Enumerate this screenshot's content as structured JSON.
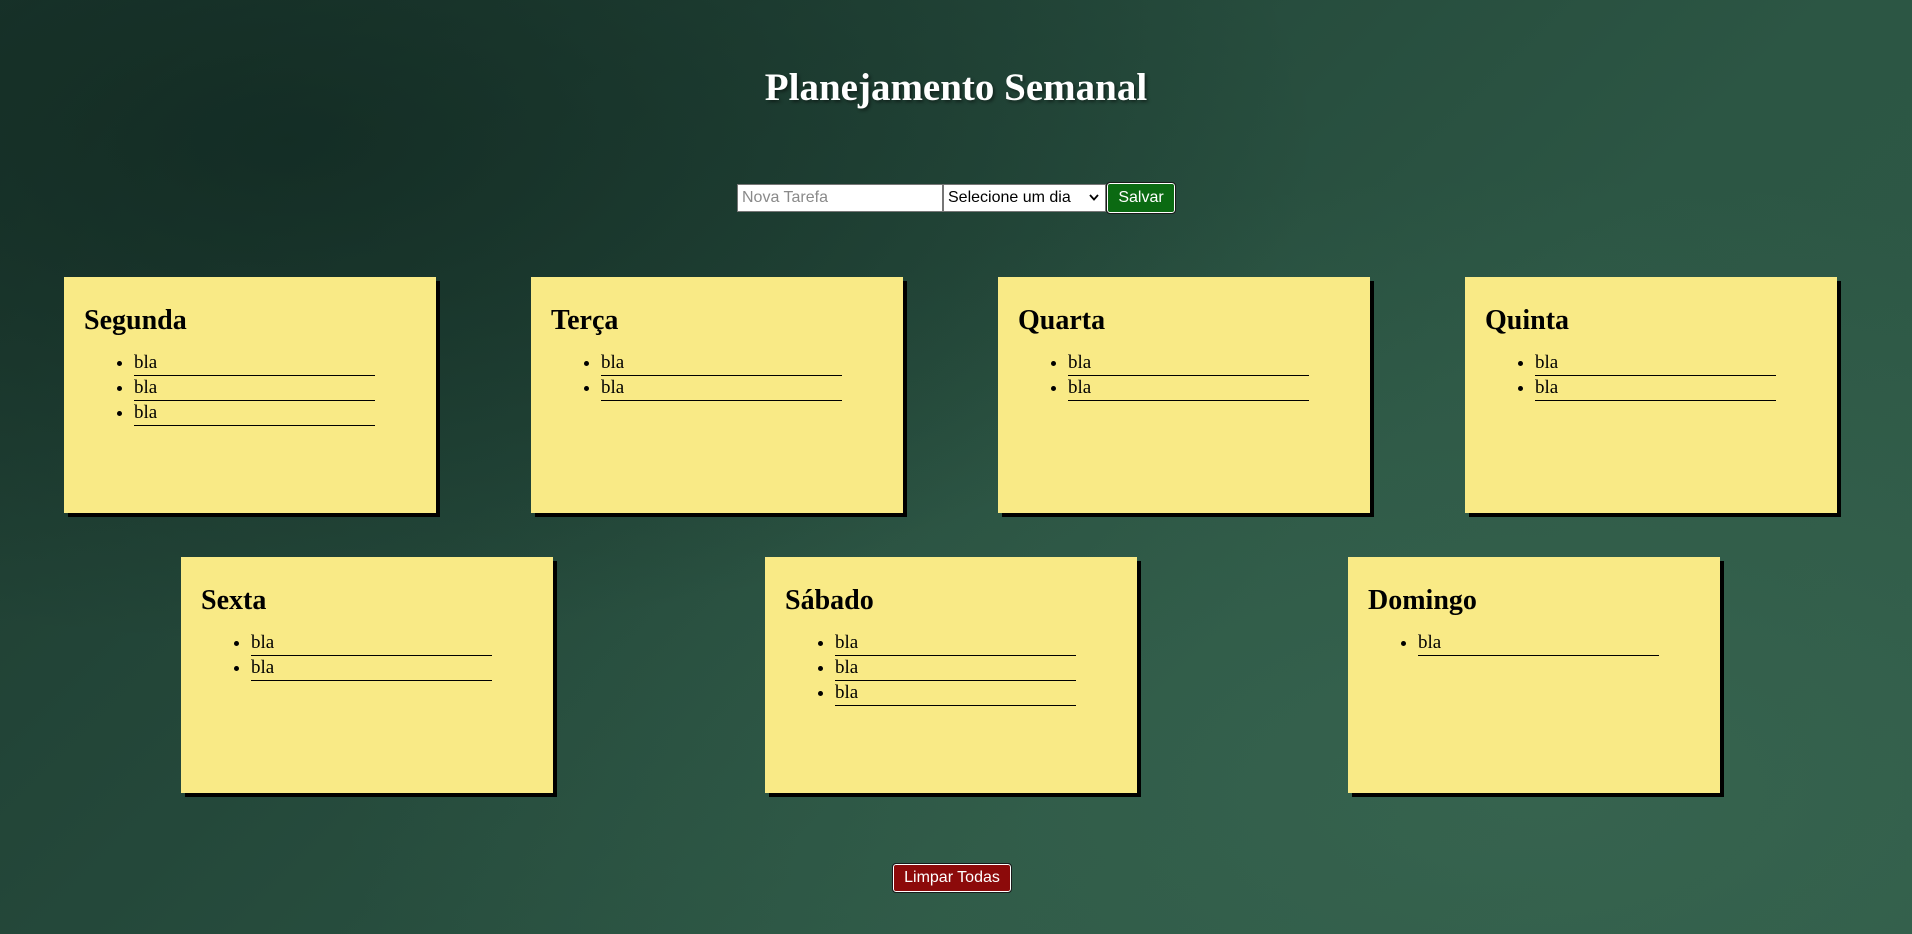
{
  "header": {
    "title": "Planejamento Semanal"
  },
  "form": {
    "task_placeholder": "Nova Tarefa",
    "task_value": "",
    "day_select_value": "Selecione um dia",
    "save_label": "Salvar"
  },
  "days": [
    {
      "name": "Segunda",
      "tasks": [
        "bla",
        "bla",
        "bla"
      ]
    },
    {
      "name": "Terça",
      "tasks": [
        "bla",
        "bla"
      ]
    },
    {
      "name": "Quarta",
      "tasks": [
        "bla",
        "bla"
      ]
    },
    {
      "name": "Quinta",
      "tasks": [
        "bla",
        "bla"
      ]
    },
    {
      "name": "Sexta",
      "tasks": [
        "bla",
        "bla"
      ]
    },
    {
      "name": "Sábado",
      "tasks": [
        "bla",
        "bla",
        "bla"
      ]
    },
    {
      "name": "Domingo",
      "tasks": [
        "bla"
      ]
    }
  ],
  "footer": {
    "clear_label": "Limpar Todas"
  },
  "colors": {
    "card": "#f9ea86",
    "save_button": "#0b6a12",
    "clear_button": "#8c0a0a"
  },
  "icons": {
    "day_select": "chevron-down-icon"
  }
}
